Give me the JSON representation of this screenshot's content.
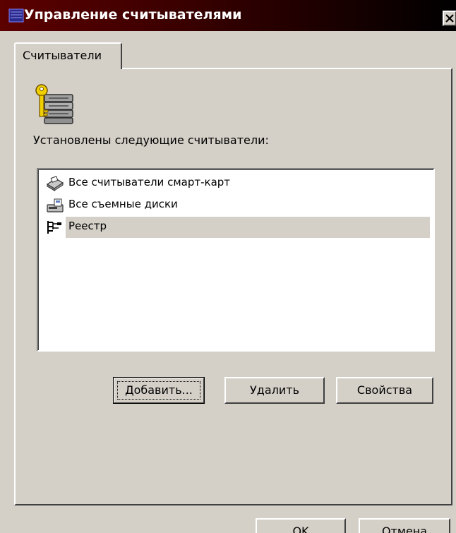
{
  "window": {
    "title": "Управление считывателями",
    "close_icon": "close-icon",
    "title_icon": "app-icon"
  },
  "tabs": [
    {
      "label": "Считыватели",
      "active": true
    }
  ],
  "panel": {
    "icon": "key-server-icon",
    "installed_label": "Установлены следующие считыватели:",
    "readers": [
      {
        "label": "Все считыватели смарт-карт",
        "icon": "smartcard-reader-icon",
        "selected": false
      },
      {
        "label": "Все съемные диски",
        "icon": "removable-disk-icon",
        "selected": false
      },
      {
        "label": "Реестр",
        "icon": "registry-icon",
        "selected": true
      }
    ],
    "buttons": {
      "add": "Добавить...",
      "remove": "Удалить",
      "properties": "Свойства"
    }
  },
  "footer": {
    "ok": "OK",
    "cancel": "Отмена"
  },
  "colors": {
    "face": "#d4d0c8",
    "title_start": "#5c0000",
    "title_end": "#000000",
    "selection": "#d4d0c8"
  }
}
